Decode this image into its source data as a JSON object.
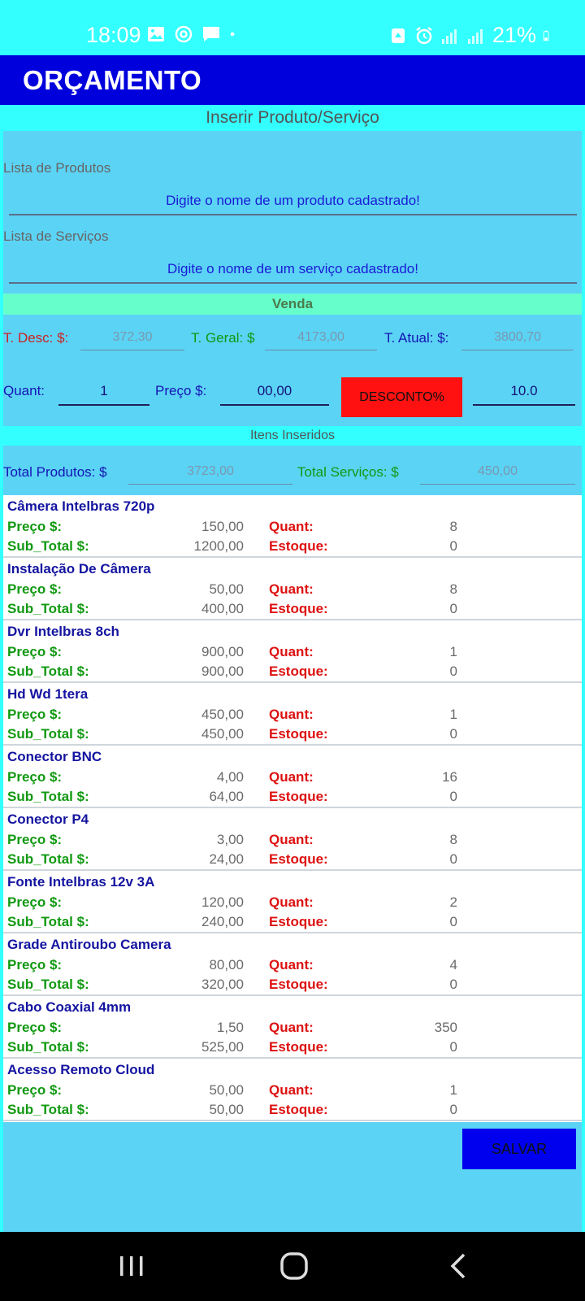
{
  "status": {
    "time": "18:09",
    "battery": "21%"
  },
  "appbar": {
    "title": "ORÇAMENTO"
  },
  "insert_header": "Inserir Produto/Serviço",
  "products": {
    "label": "Lista de Produtos",
    "placeholder": "Digite o nome de um produto cadastrado!"
  },
  "services": {
    "label": "Lista de Serviços",
    "placeholder": "Digite o nome de um serviço cadastrado!"
  },
  "venda_header": "Venda",
  "totals": {
    "desc_label": "T. Desc: $:",
    "desc_value": "372,30",
    "geral_label": "T. Geral: $",
    "geral_value": "4173,00",
    "atual_label": "T. Atual: $:",
    "atual_value": "3800,70"
  },
  "entry": {
    "quant_label": "Quant:",
    "quant_value": "1",
    "preco_label": "Preço $:",
    "preco_value": "00,00",
    "desconto_button": "DESCONTO%",
    "desconto_value": "10.0"
  },
  "itens_header": "Itens Inseridos",
  "summary": {
    "produtos_label": "Total Produtos: $",
    "produtos_value": "3723,00",
    "servicos_label": "Total Serviços: $",
    "servicos_value": "450,00"
  },
  "item_labels": {
    "preco": "Preço $:",
    "subtotal": "Sub_Total $:",
    "quant": "Quant:",
    "estoque": "Estoque:"
  },
  "items": [
    {
      "name": "Câmera Intelbras 720p",
      "preco": "150,00",
      "subtotal": "1200,00",
      "quant": "8",
      "estoque": "0"
    },
    {
      "name": "Instalação De Câmera",
      "preco": "50,00",
      "subtotal": "400,00",
      "quant": "8",
      "estoque": "0"
    },
    {
      "name": "Dvr Intelbras 8ch",
      "preco": "900,00",
      "subtotal": "900,00",
      "quant": "1",
      "estoque": "0"
    },
    {
      "name": "Hd Wd 1tera",
      "preco": "450,00",
      "subtotal": "450,00",
      "quant": "1",
      "estoque": "0"
    },
    {
      "name": "Conector BNC",
      "preco": "4,00",
      "subtotal": "64,00",
      "quant": "16",
      "estoque": "0"
    },
    {
      "name": "Conector P4",
      "preco": "3,00",
      "subtotal": "24,00",
      "quant": "8",
      "estoque": "0"
    },
    {
      "name": "Fonte Intelbras 12v 3A",
      "preco": "120,00",
      "subtotal": "240,00",
      "quant": "2",
      "estoque": "0"
    },
    {
      "name": "Grade Antiroubo Camera",
      "preco": "80,00",
      "subtotal": "320,00",
      "quant": "4",
      "estoque": "0"
    },
    {
      "name": "Cabo Coaxial 4mm",
      "preco": "1,50",
      "subtotal": "525,00",
      "quant": "350",
      "estoque": "0"
    },
    {
      "name": "Acesso Remoto Cloud",
      "preco": "50,00",
      "subtotal": "50,00",
      "quant": "1",
      "estoque": "0"
    }
  ],
  "save_button": "SALVAR",
  "icons": {
    "status_left": [
      "gallery-icon",
      "sync-icon",
      "message-icon",
      "dot-icon"
    ],
    "status_right": [
      "recycle-icon",
      "alarm-icon",
      "signal-icon",
      "signal-icon",
      "battery-icon"
    ],
    "nav": [
      "recents-icon",
      "home-icon",
      "back-icon"
    ]
  },
  "colors": {
    "accent": "#0000dd",
    "background": "#5bd3f5",
    "header": "#33ffff",
    "discount": "#ff1111"
  }
}
